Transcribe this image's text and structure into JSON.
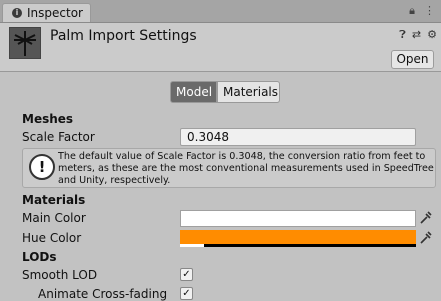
{
  "tab": {
    "icon": "info-icon",
    "label": "Inspector"
  },
  "header": {
    "title": "Palm Import Settings",
    "open_label": "Open",
    "icons": [
      "help-icon",
      "presets-icon",
      "settings-icon"
    ]
  },
  "modes": {
    "model": "Model",
    "materials": "Materials",
    "selected": "Model"
  },
  "meshes": {
    "heading": "Meshes",
    "scale_label": "Scale Factor",
    "scale_value": "0.3048",
    "help": "The default value of Scale Factor is 0.3048, the conversion ratio from feet to meters, as these are the most conventional measurements used in SpeedTree and Unity, respectively."
  },
  "materials": {
    "heading": "Materials",
    "main_color_label": "Main Color",
    "main_color": "#ffffff",
    "hue_color_label": "Hue Color",
    "hue_color": "#ff8c00"
  },
  "lods": {
    "heading": "LODs",
    "smooth_label": "Smooth LOD",
    "smooth_checked": true,
    "crossfade_label": "Animate Cross-fading",
    "crossfade_checked": true
  }
}
